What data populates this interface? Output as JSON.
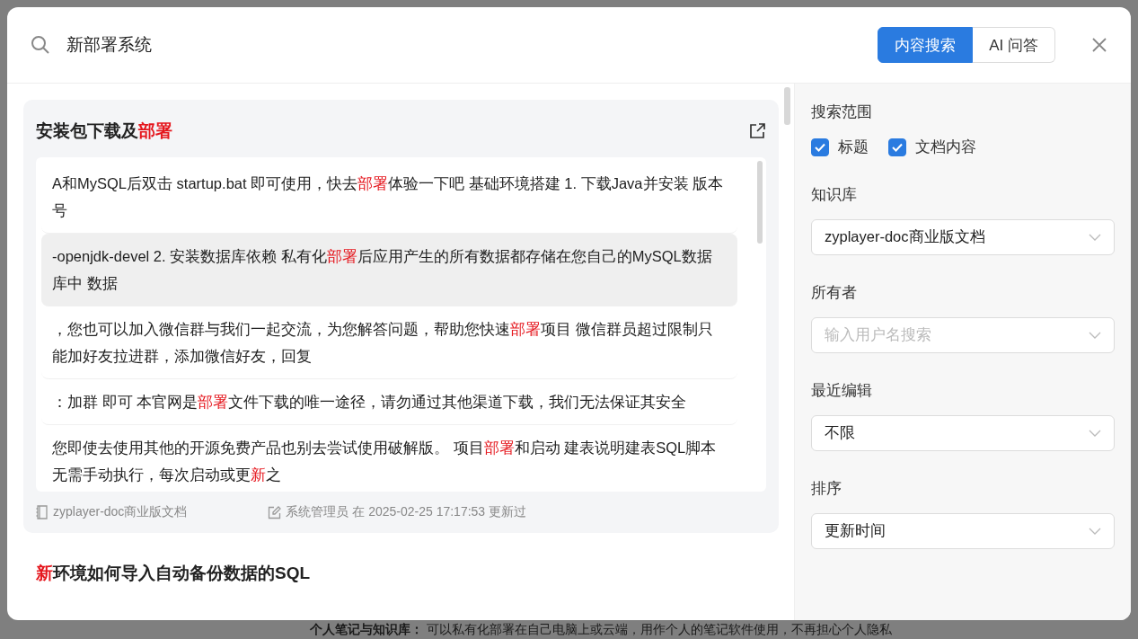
{
  "search": {
    "value": "新部署系统"
  },
  "tabs": [
    {
      "label": "内容搜索",
      "selected": true
    },
    {
      "label": "AI 问答",
      "selected": false
    }
  ],
  "results": [
    {
      "title": [
        {
          "text": "安装包下载及",
          "highlight": false
        },
        {
          "text": "部署",
          "highlight": true
        }
      ],
      "snippets": [
        {
          "selected": false,
          "parts": [
            {
              "text": "A和MySQL后双击 startup.bat 即可使用，快去",
              "highlight": false
            },
            {
              "text": "部署",
              "highlight": true
            },
            {
              "text": "体验一下吧 基础环境搭建 1. 下载Java并安装 版本号",
              "highlight": false
            }
          ]
        },
        {
          "selected": true,
          "parts": [
            {
              "text": "-openjdk-devel 2. 安装数据库依赖 私有化",
              "highlight": false
            },
            {
              "text": "部署",
              "highlight": true
            },
            {
              "text": "后应用产生的所有数据都存储在您自己的MySQL数据库中 数据",
              "highlight": false
            }
          ]
        },
        {
          "selected": false,
          "parts": [
            {
              "text": "，您也可以加入微信群与我们一起交流，为您解答问题，帮助您快速",
              "highlight": false
            },
            {
              "text": "部署",
              "highlight": true
            },
            {
              "text": "项目 微信群员超过限制只能加好友拉进群，添加微信好友，回复",
              "highlight": false
            }
          ]
        },
        {
          "selected": false,
          "parts": [
            {
              "text": "：加群 即可 本官网是",
              "highlight": false
            },
            {
              "text": "部署",
              "highlight": true
            },
            {
              "text": "文件下载的唯一途径，请勿通过其他渠道下载，我们无法保证其安全",
              "highlight": false
            }
          ]
        },
        {
          "selected": false,
          "parts": [
            {
              "text": "您即使去使用其他的开源免费产品也别去尝试使用破解版。 项目",
              "highlight": false
            },
            {
              "text": "部署",
              "highlight": true
            },
            {
              "text": "和启动 建表说明建表SQL脚本无需手动执行，每次启动或更",
              "highlight": false
            },
            {
              "text": "新",
              "highlight": true
            },
            {
              "text": "之",
              "highlight": false
            }
          ]
        }
      ],
      "space": "zyplayer-doc商业版文档",
      "meta": "系统管理员 在 2025-02-25 17:17:53 更新过"
    },
    {
      "title": [
        {
          "text": "新",
          "highlight": true
        },
        {
          "text": "环境如何导入自动备份数据的SQL",
          "highlight": false
        }
      ]
    }
  ],
  "filters": {
    "scope_label": "搜索范围",
    "scope": [
      {
        "label": "标题",
        "checked": true
      },
      {
        "label": "文档内容",
        "checked": true
      }
    ],
    "selects": [
      {
        "label": "知识库",
        "value": "zyplayer-doc商业版文档"
      },
      {
        "label": "所有者",
        "placeholder": "输入用户名搜索"
      },
      {
        "label": "最近编辑",
        "value": "不限"
      },
      {
        "label": "排序",
        "value": "更新时间"
      }
    ]
  },
  "background_text": "**个人笔记与知识库：** 可以私有化部署在自己电脑上或云端，用作个人的笔记软件使用，不再担心个人隐私"
}
